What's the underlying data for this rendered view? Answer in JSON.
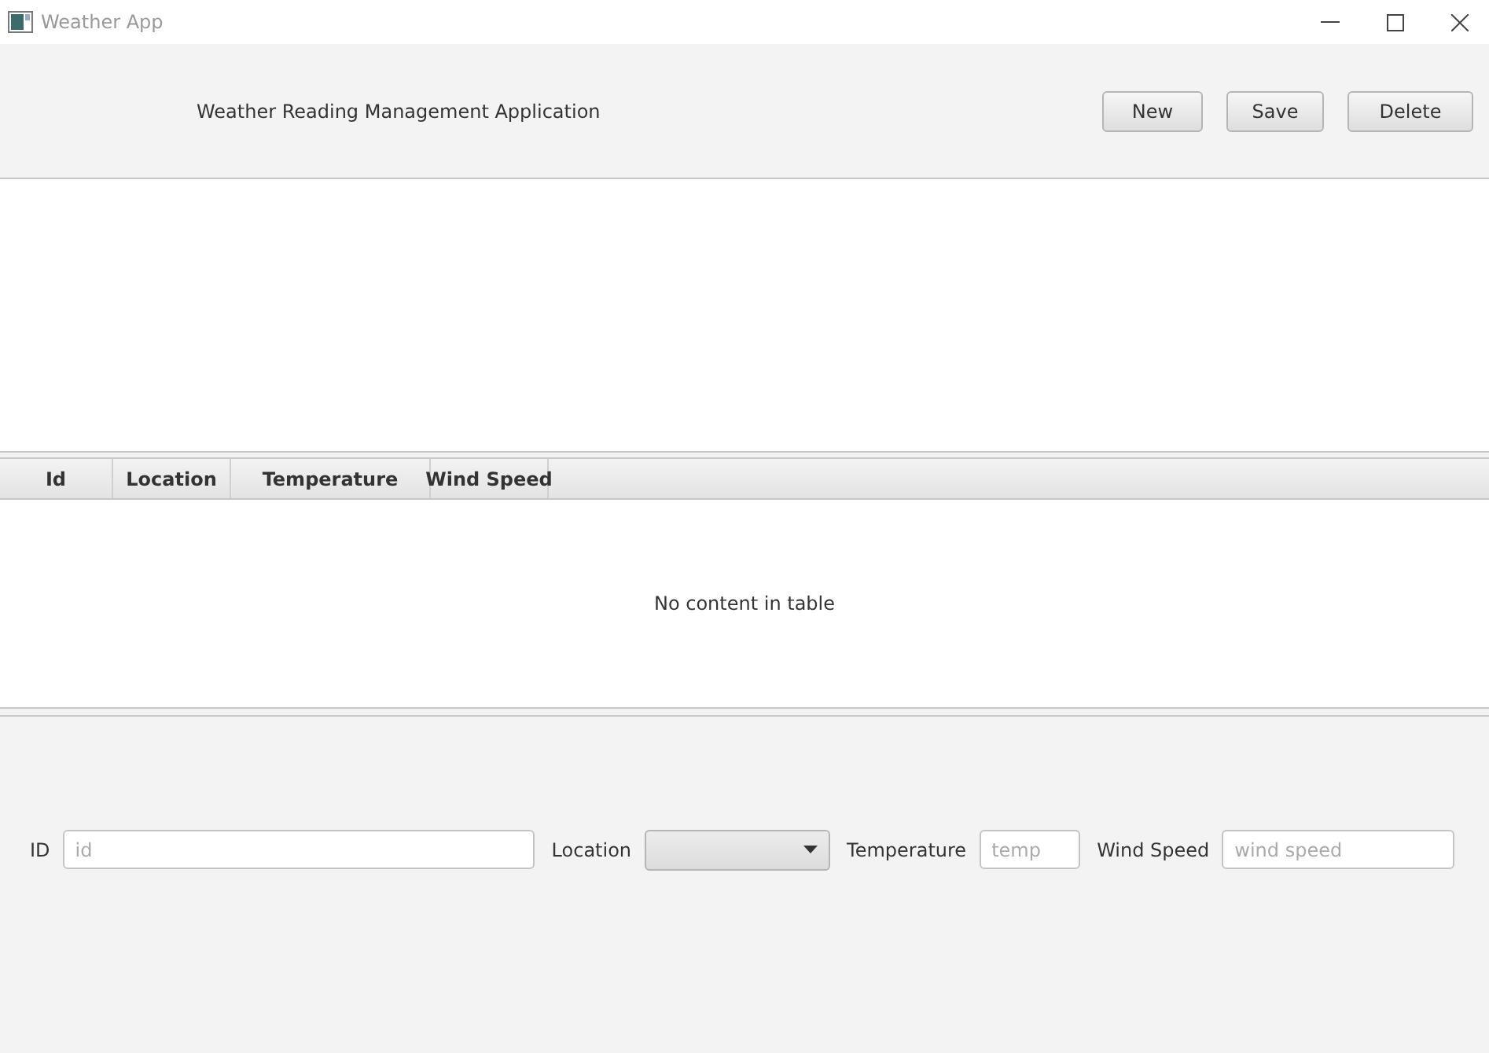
{
  "window": {
    "title": "Weather App"
  },
  "header": {
    "title": "Weather Reading Management Application",
    "buttons": [
      "New",
      "Save",
      "Delete"
    ]
  },
  "table": {
    "columns": [
      "Id",
      "Location",
      "Temperature",
      "Wind Speed"
    ],
    "empty_message": "No content in table"
  },
  "form": [
    {
      "kind": "text",
      "label": "ID",
      "placeholder": "id"
    },
    {
      "kind": "combo",
      "label": "Location"
    },
    {
      "kind": "text",
      "label": "Temperature",
      "placeholder": "temp"
    },
    {
      "kind": "text",
      "label": "Wind Speed",
      "placeholder": "wind speed"
    }
  ]
}
